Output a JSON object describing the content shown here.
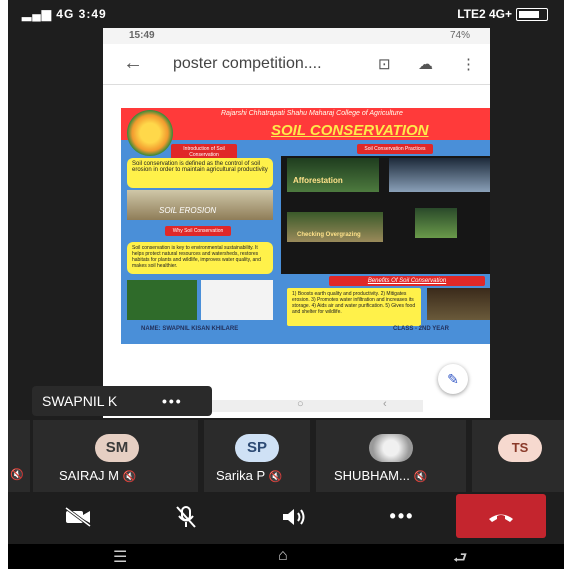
{
  "status_bar": {
    "left": "4G",
    "time": "3:49",
    "right": "LTE2 4G+"
  },
  "shared_screen": {
    "status_time": "15:49",
    "status_battery": "74%",
    "doc_title": "poster competition....",
    "poster": {
      "college": "Rajarshi Chhatrapati Shahu Maharaj College of Agriculture",
      "title": "SOIL CONSERVATION",
      "intro_badge": "Introduction of Soil Conservation",
      "intro_text": "Soil conservation is defined as the control of soil erosion in order to maintain agricultural productivity",
      "photo_label": "SOIL EROSION",
      "why_badge": "Why Soil Conservation",
      "why_text": "Soil conservation is key to environmental sustainability. It helps protect natural resources and watersheds, restores habitats for plants and wildlife, improves water quality, and makes soil healthier.",
      "practices_badge": "Soil Conservation Practices",
      "afforestation": "Afforestation",
      "grazing": "Checking Overgrazing",
      "benefits_badge": "Benefits Of Soil Conservation",
      "benefits_text": "1) Boosts earth quality and productivity. 2) Mitigates erosion. 3) Promotes water infiltration and increases its storage. 4) Aids air and water purification. 5) Gives food and shelter for wildlife.",
      "name": "NAME: SWAPNIL KISAN KHILARE",
      "class": "CLASS - 2ND YEAR"
    }
  },
  "presenter_label": "SWAPNIL K",
  "participants": [
    {
      "initials": "",
      "name": ""
    },
    {
      "initials": "SM",
      "name": "SAIRAJ M"
    },
    {
      "initials": "SP",
      "name": "Sarika P"
    },
    {
      "initials": "",
      "name": "SHUBHAM..."
    },
    {
      "initials": "TS",
      "name": ""
    }
  ],
  "controls": {
    "camera": "camera-off-icon",
    "mic": "mic-off-icon",
    "speaker": "speaker-icon",
    "more": "•••",
    "hangup": "hang-up-icon"
  },
  "colors": {
    "hangup": "#c4252e",
    "avatar_sm": "#e6cfc3",
    "avatar_sp": "#cfe1f5",
    "avatar_ts": "#f6d9cf"
  }
}
